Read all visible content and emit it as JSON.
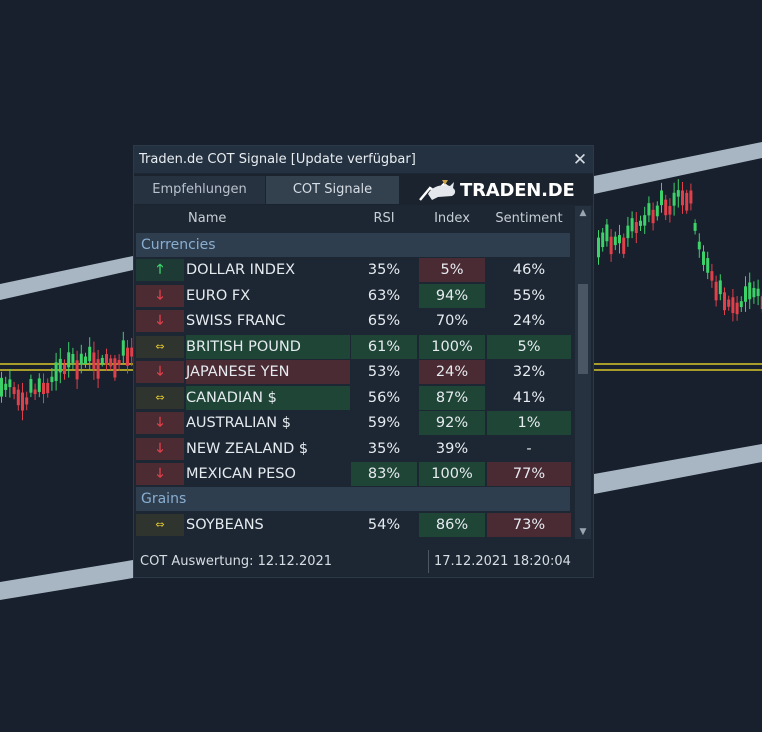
{
  "window": {
    "title": "Traden.de COT Signale [Update verfügbar]",
    "close_symbol": "✕"
  },
  "tabs": [
    {
      "label": "Empfehlungen"
    },
    {
      "label": "COT Signale"
    }
  ],
  "logo": {
    "text": "TRADEN.DE"
  },
  "columns": {
    "name": "Name",
    "rsi": "RSI",
    "index": "Index",
    "sentiment": "Sentiment"
  },
  "groups": [
    {
      "label": "Currencies"
    },
    {
      "label": "Grains"
    }
  ],
  "rows": [
    {
      "icon": "arrow-up-icon",
      "name": "DOLLAR INDEX",
      "rsi": "35%",
      "index": "5%",
      "sentiment": "46%"
    },
    {
      "icon": "arrow-down-icon",
      "name": "EURO FX",
      "rsi": "63%",
      "index": "94%",
      "sentiment": "55%"
    },
    {
      "icon": "arrow-down-icon",
      "name": "SWISS FRANC",
      "rsi": "65%",
      "index": "70%",
      "sentiment": "24%"
    },
    {
      "icon": "arrow-left-right-icon",
      "name": "BRITISH POUND",
      "rsi": "61%",
      "index": "100%",
      "sentiment": "5%"
    },
    {
      "icon": "arrow-down-icon",
      "name": "JAPANESE YEN",
      "rsi": "53%",
      "index": "24%",
      "sentiment": "32%"
    },
    {
      "icon": "arrow-left-right-icon",
      "name": "CANADIAN $",
      "rsi": "56%",
      "index": "87%",
      "sentiment": "41%"
    },
    {
      "icon": "arrow-down-icon",
      "name": "AUSTRALIAN $",
      "rsi": "59%",
      "index": "92%",
      "sentiment": "1%"
    },
    {
      "icon": "arrow-down-icon",
      "name": "NEW ZEALAND $",
      "rsi": "35%",
      "index": "39%",
      "sentiment": "-"
    },
    {
      "icon": "arrow-down-icon",
      "name": "MEXICAN PESO",
      "rsi": "83%",
      "index": "100%",
      "sentiment": "77%"
    },
    {
      "icon": "arrow-left-right-icon",
      "name": "SOYBEANS",
      "rsi": "54%",
      "index": "86%",
      "sentiment": "73%"
    }
  ],
  "footer": {
    "evaluation": "COT Auswertung: 12.12.2021",
    "timestamp": "17.12.2021 18:20:04"
  },
  "colors": {
    "background": "#17202c",
    "panel": "#1d2733",
    "bull": "#3dd16a",
    "bear": "#e0404a",
    "neutral": "#d8c030",
    "cell_green": "#1f4536",
    "cell_red": "#4a2a33"
  }
}
